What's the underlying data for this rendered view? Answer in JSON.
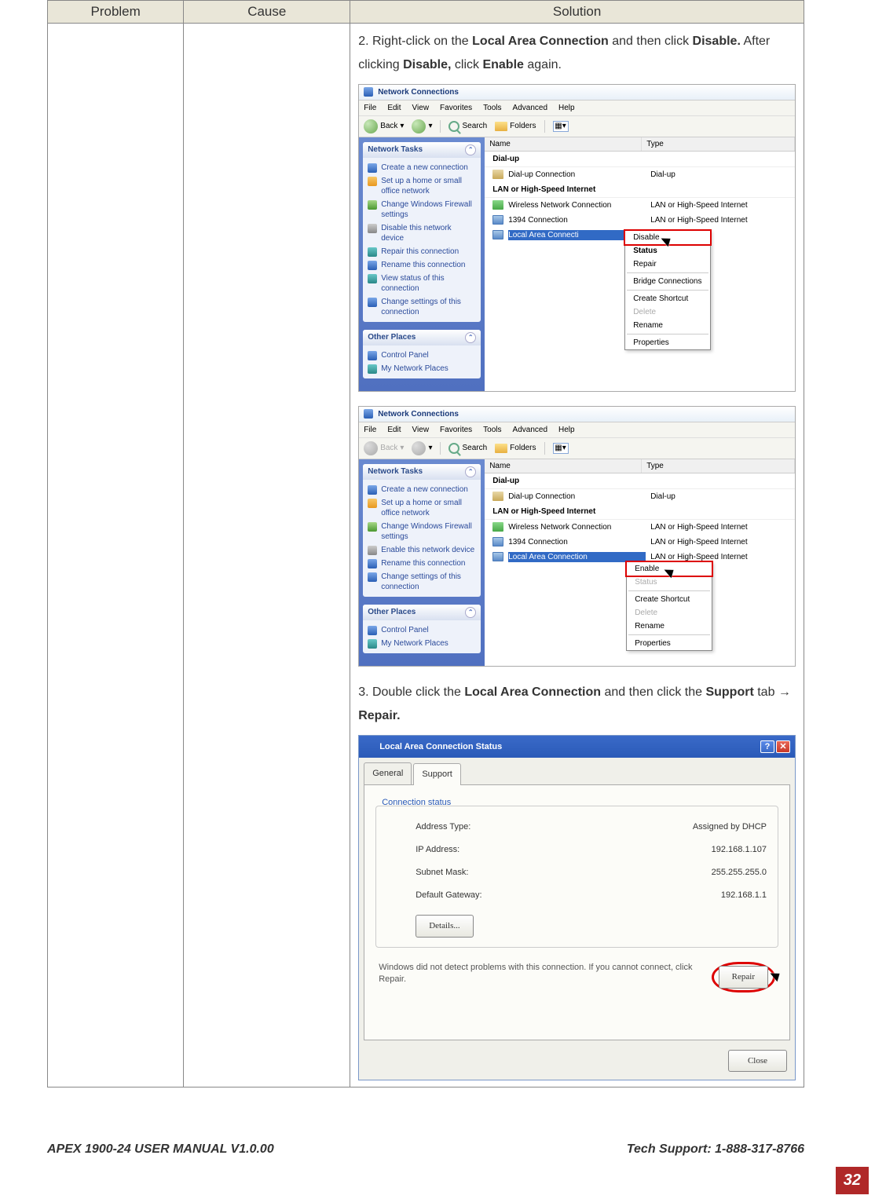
{
  "table": {
    "headers": [
      "Problem",
      "Cause",
      "Solution"
    ]
  },
  "step2": {
    "prefix": "2. Right-click on the ",
    "b1": "Local Area Connection",
    "mid1": " and then click ",
    "b2": "Disable.",
    "mid2": " After clicking ",
    "b3": "Disable,",
    "mid3": " click ",
    "b4": "Enable",
    "suffix": " again."
  },
  "step3": {
    "prefix": "3. Double click the ",
    "b1": "Local Area Connection",
    "mid1": " and then click the ",
    "b2": "Support",
    "mid2": " tab → ",
    "b3": "Repair."
  },
  "win": {
    "title": "Network Connections",
    "menus": [
      "File",
      "Edit",
      "View",
      "Favorites",
      "Tools",
      "Advanced",
      "Help"
    ],
    "back": "Back",
    "search": "Search",
    "folders": "Folders",
    "col_name": "Name",
    "col_type": "Type",
    "section_dialup": "Dial-up",
    "section_lan": "LAN or High-Speed Internet",
    "dialup_conn": "Dial-up Connection",
    "dialup_type": "Dial-up",
    "wireless": "Wireless Network Connection",
    "c1394": "1394 Connection",
    "lac": "Local Area Connection",
    "lac_short": "Local Area Connecti",
    "lan_type": "LAN or High-Speed Internet",
    "tasks_head": "Network Tasks",
    "tasks": [
      "Create a new connection",
      "Set up a home or small office network",
      "Change Windows Firewall settings",
      "Disable this network device",
      "Repair this connection",
      "Rename this connection",
      "View status of this connection",
      "Change settings of this connection"
    ],
    "tasks_enable": "Enable this network device",
    "other_head": "Other Places",
    "other_cp": "Control Panel",
    "other_mnp": "My Network Places"
  },
  "ctx1": {
    "items": [
      "Disable",
      "Status",
      "Repair",
      "Bridge Connections",
      "Create Shortcut",
      "Delete",
      "Rename",
      "Properties"
    ]
  },
  "ctx2": {
    "items": [
      "Enable",
      "Status",
      "Create Shortcut",
      "Delete",
      "Rename",
      "Properties"
    ]
  },
  "dlg": {
    "title": "Local Area Connection Status",
    "tab_general": "General",
    "tab_support": "Support",
    "group": "Connection status",
    "addr_type_label": "Address Type:",
    "addr_type": "Assigned by DHCP",
    "ip_label": "IP Address:",
    "ip": "192.168.1.107",
    "mask_label": "Subnet Mask:",
    "mask": "255.255.255.0",
    "gw_label": "Default Gateway:",
    "gw": "192.168.1.1",
    "details": "Details...",
    "repair_text": "Windows did not detect problems with this connection. If you cannot connect, click Repair.",
    "repair": "Repair",
    "close": "Close"
  },
  "footer": {
    "left": "APEX 1900-24 USER MANUAL V1.0.00",
    "right": "Tech Support: 1-888-317-8766",
    "page": "32"
  }
}
